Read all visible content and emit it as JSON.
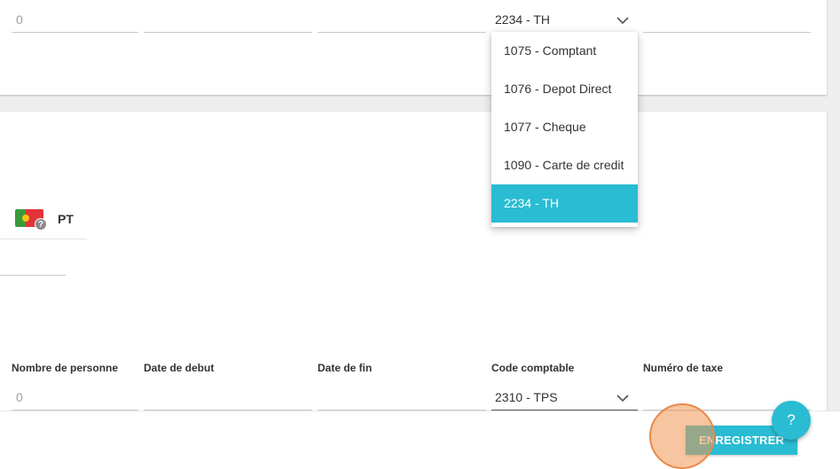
{
  "top_row": {
    "person_count_value": "0",
    "account_code_value": "2234 - TH"
  },
  "dropdown": {
    "options": [
      {
        "label": "1075 - Comptant",
        "selected": false
      },
      {
        "label": "1076 - Depot Direct",
        "selected": false
      },
      {
        "label": "1077 - Cheque",
        "selected": false
      },
      {
        "label": "1090 - Carte de credit",
        "selected": false
      },
      {
        "label": "2234 - TH",
        "selected": true
      }
    ]
  },
  "language": {
    "code": "PT",
    "flag_icon": "portugal-flag-icon",
    "help_mark": "?"
  },
  "tax_row": {
    "labels": {
      "person_count": "Nombre de personne",
      "start_date": "Date de debut",
      "end_date": "Date de fin",
      "account_code": "Code comptable",
      "tax_number": "Numéro de taxe"
    },
    "person_count_value": "0",
    "account_code_value": "2310 - TPS"
  },
  "actions": {
    "save_label": "ENREGISTRER",
    "help_label": "?"
  },
  "colors": {
    "accent": "#29bcd2",
    "click_indicator": "#e8894a"
  }
}
